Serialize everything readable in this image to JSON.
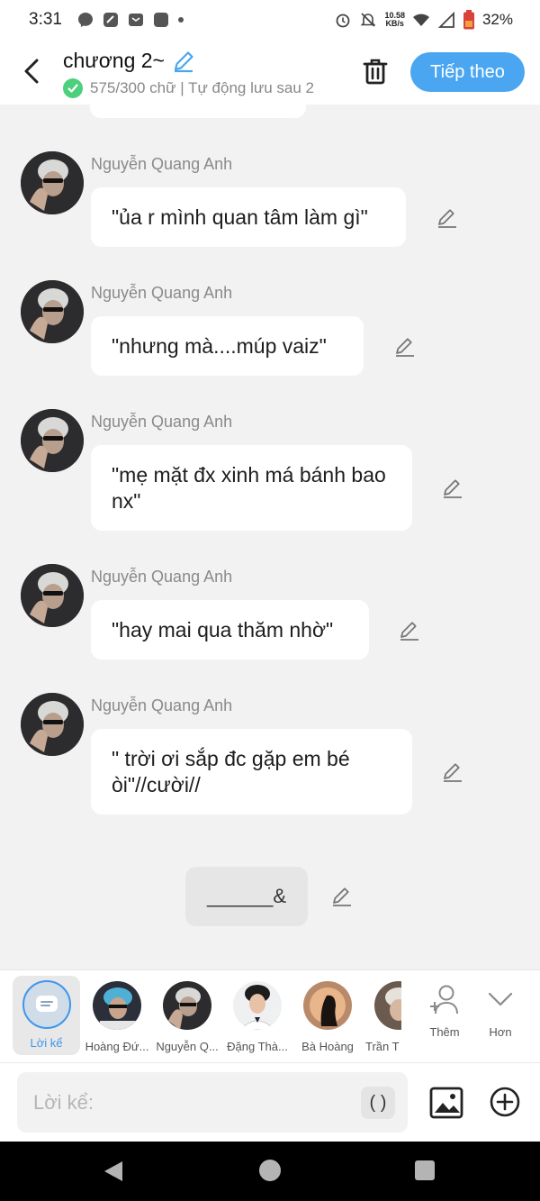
{
  "status_bar": {
    "time": "3:31",
    "net_speed_value": "10.58",
    "net_speed_unit": "KB/s",
    "battery": "32%"
  },
  "header": {
    "chapter_title": "chương 2~",
    "save_status": "575/300 chữ | Tự động lưu sau 2",
    "next_label": "Tiếp theo"
  },
  "messages": [
    {
      "sender": "Nguyễn Quang Anh",
      "text": "\"ủa r mình quan tâm làm gì\""
    },
    {
      "sender": "Nguyễn Quang Anh",
      "text": "\"nhưng mà....múp vaiz\""
    },
    {
      "sender": "Nguyễn Quang Anh",
      "text": "\"mẹ mặt đx xinh má bánh bao nx\""
    },
    {
      "sender": "Nguyễn Quang Anh",
      "text": "\"hay mai qua thăm nhờ\""
    },
    {
      "sender": "Nguyễn Quang Anh",
      "text": "\" trời ơi sắp đc gặp em bé òi\"//cười//"
    }
  ],
  "separator_text": "______&",
  "characters": {
    "narrator": "Lời kể",
    "list": [
      {
        "name": "Hoàng Đứ..."
      },
      {
        "name": "Nguyễn Q..."
      },
      {
        "name": "Đặng Thà..."
      },
      {
        "name": "Bà Hoàng"
      },
      {
        "name": "Trần T"
      }
    ],
    "more_label": "Thêm",
    "expand_label": "Hơn"
  },
  "input": {
    "placeholder": "Lời kể:",
    "paren_label": "( )"
  },
  "colors": {
    "accent": "#4aa6f1",
    "check": "#4cd07d",
    "background": "#f2f2f2"
  }
}
